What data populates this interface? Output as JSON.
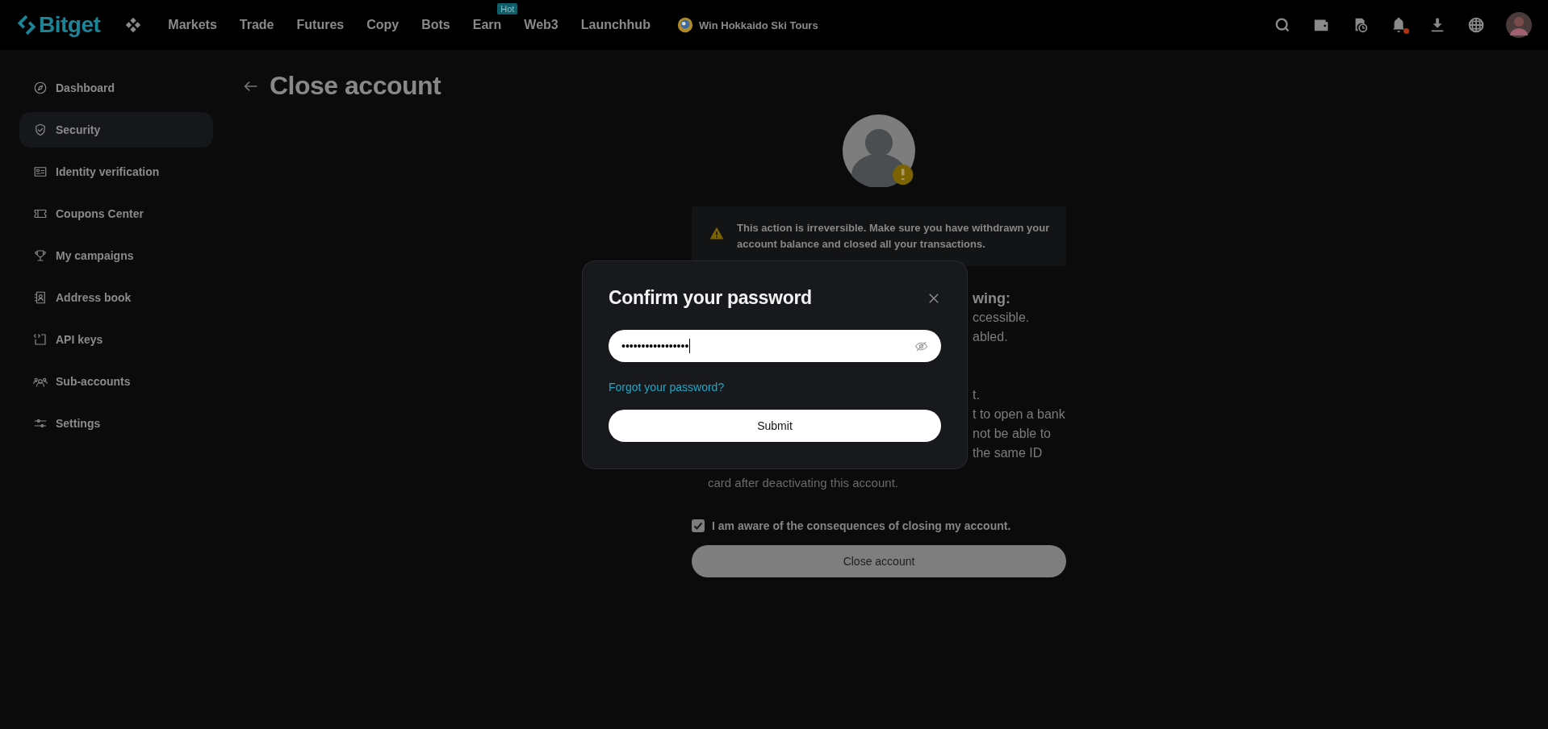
{
  "nav": {
    "logo": "Bitget",
    "items": [
      {
        "label": "Markets"
      },
      {
        "label": "Trade"
      },
      {
        "label": "Futures"
      },
      {
        "label": "Copy"
      },
      {
        "label": "Bots"
      },
      {
        "label": "Earn",
        "badge": "Hot"
      },
      {
        "label": "Web3"
      },
      {
        "label": "Launchhub"
      }
    ],
    "promo": "Win Hokkaido Ski Tours",
    "notification_dot": true
  },
  "sidebar": {
    "items": [
      {
        "label": "Dashboard",
        "selected": false
      },
      {
        "label": "Security",
        "selected": true
      },
      {
        "label": "Identity verification",
        "selected": false
      },
      {
        "label": "Coupons Center",
        "selected": false
      },
      {
        "label": "My campaigns",
        "selected": false
      },
      {
        "label": "Address book",
        "selected": false
      },
      {
        "label": "API keys",
        "selected": false
      },
      {
        "label": "Sub-accounts",
        "selected": false
      },
      {
        "label": "Settings",
        "selected": false
      }
    ]
  },
  "page": {
    "title": "Close account",
    "warning": "This action is irreversible. Make sure you have withdrawn your account balance and closed all your transactions.",
    "partial_heading": "wing:",
    "partial_lines": [
      {
        "text": "ccessible."
      },
      {
        "text": "abled."
      }
    ],
    "partial_lines_2": [
      {
        "text": "t."
      },
      {
        "text": "t to open a bank"
      },
      {
        "text": "not be able to"
      },
      {
        "text": "the same ID"
      }
    ],
    "partial_last_line": "card after deactivating this account.",
    "consent": {
      "label": "I am aware of the consequences of closing my account.",
      "checked": true
    },
    "close_button": "Close account"
  },
  "dialog": {
    "title": "Confirm your password",
    "password": "•••••••••••••••••",
    "forgot_link": "Forgot your password?",
    "submit": "Submit"
  }
}
